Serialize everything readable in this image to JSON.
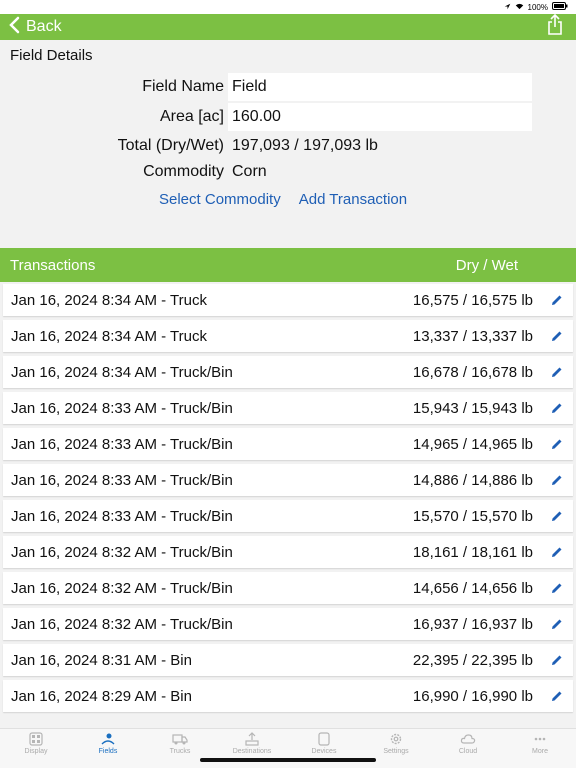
{
  "status": {
    "battery": "100%"
  },
  "nav": {
    "back_label": "Back",
    "share_icon": "share-icon"
  },
  "section_title": "Field Details",
  "fields": {
    "name_label": "Field Name",
    "name_value": "Field",
    "area_label": "Area [ac]",
    "area_value": "160.00",
    "total_label": "Total (Dry/Wet)",
    "total_value": "197,093 / 197,093 lb",
    "commodity_label": "Commodity",
    "commodity_value": "Corn"
  },
  "actions": {
    "select_commodity": "Select Commodity",
    "add_transaction": "Add Transaction"
  },
  "transactions": {
    "header_left": "Transactions",
    "header_right": "Dry / Wet",
    "rows": [
      {
        "desc": "Jan 16, 2024 8:34 AM - Truck",
        "weight": "16,575 / 16,575 lb"
      },
      {
        "desc": "Jan 16, 2024 8:34 AM - Truck",
        "weight": "13,337 / 13,337 lb"
      },
      {
        "desc": "Jan 16, 2024 8:34 AM - Truck/Bin",
        "weight": "16,678 / 16,678 lb"
      },
      {
        "desc": "Jan 16, 2024 8:33 AM - Truck/Bin",
        "weight": "15,943 / 15,943 lb"
      },
      {
        "desc": "Jan 16, 2024 8:33 AM - Truck/Bin",
        "weight": "14,965 / 14,965 lb"
      },
      {
        "desc": "Jan 16, 2024 8:33 AM - Truck/Bin",
        "weight": "14,886 / 14,886 lb"
      },
      {
        "desc": "Jan 16, 2024 8:33 AM - Truck/Bin",
        "weight": "15,570 / 15,570 lb"
      },
      {
        "desc": "Jan 16, 2024 8:32 AM - Truck/Bin",
        "weight": "18,161 / 18,161 lb"
      },
      {
        "desc": "Jan 16, 2024 8:32 AM - Truck/Bin",
        "weight": "14,656 / 14,656 lb"
      },
      {
        "desc": "Jan 16, 2024 8:32 AM - Truck/Bin",
        "weight": "16,937 / 16,937 lb"
      },
      {
        "desc": "Jan 16, 2024 8:31 AM - Bin",
        "weight": "22,395 / 22,395 lb"
      },
      {
        "desc": "Jan 16, 2024 8:29 AM - Bin",
        "weight": "16,990 / 16,990 lb"
      }
    ]
  },
  "tabs": [
    {
      "label": "Display",
      "icon": "display-icon",
      "active": false
    },
    {
      "label": "Fields",
      "icon": "fields-icon",
      "active": true
    },
    {
      "label": "Trucks",
      "icon": "truck-icon",
      "active": false
    },
    {
      "label": "Destinations",
      "icon": "destinations-icon",
      "active": false
    },
    {
      "label": "Devices",
      "icon": "devices-icon",
      "active": false
    },
    {
      "label": "Settings",
      "icon": "gear-icon",
      "active": false
    },
    {
      "label": "Cloud",
      "icon": "cloud-icon",
      "active": false
    },
    {
      "label": "More",
      "icon": "more-icon",
      "active": false
    }
  ],
  "colors": {
    "accent_green": "#7cc043",
    "link_blue": "#1f5fb5",
    "active_tab": "#1a6fc0"
  }
}
